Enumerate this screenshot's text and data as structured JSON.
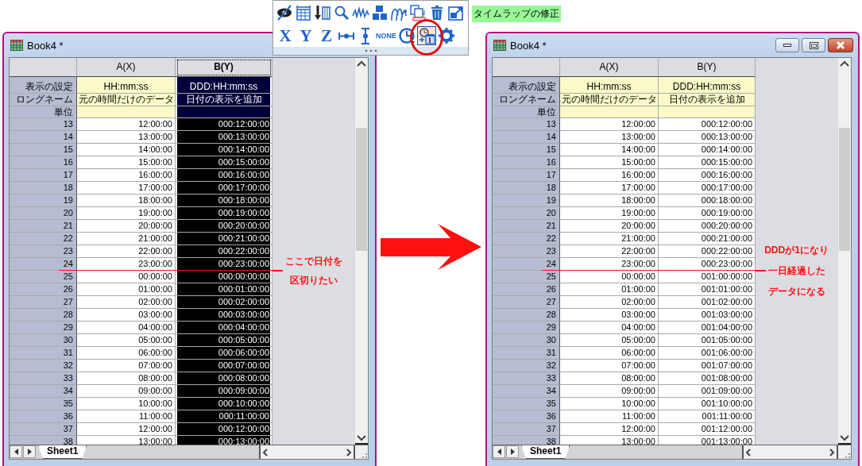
{
  "toolbar": {
    "rows": [
      {
        "buttons": [
          {
            "kind": "hide",
            "highlighted": false
          },
          {
            "kind": "table",
            "highlighted": false
          },
          {
            "kind": "fill",
            "highlighted": false
          },
          {
            "kind": "zoom",
            "highlighted": false
          },
          {
            "kind": "wave",
            "highlighted": false
          },
          {
            "kind": "tiles",
            "highlighted": false
          },
          {
            "kind": "plot",
            "highlighted": false
          },
          {
            "kind": "copy",
            "highlighted": false
          },
          {
            "kind": "delete",
            "highlighted": false
          },
          {
            "kind": "export",
            "highlighted": false
          }
        ]
      },
      {
        "buttons": [
          {
            "kind": "x",
            "label": "X",
            "highlighted": false
          },
          {
            "kind": "y",
            "label": "Y",
            "highlighted": false
          },
          {
            "kind": "z",
            "label": "Z",
            "highlighted": false
          },
          {
            "kind": "xbar",
            "highlighted": false
          },
          {
            "kind": "ybar",
            "highlighted": false
          },
          {
            "kind": "none",
            "label": "NONE",
            "highlighted": false
          },
          {
            "kind": "clock",
            "highlighted": false
          },
          {
            "kind": "timeshift",
            "highlighted": true
          },
          {
            "kind": "settings",
            "highlighted": false
          }
        ]
      }
    ],
    "label": "タイムラップの修正"
  },
  "windows": [
    {
      "title": "Book4 *",
      "caption_buttons": false,
      "columns": [
        {
          "label": "A(X)",
          "selected": false
        },
        {
          "label": "B(Y)",
          "selected": true
        }
      ],
      "label_rows": [
        {
          "label": "表示の設定",
          "cells": [
            "HH:mm:ss",
            "DDD:HH:mm:ss"
          ]
        },
        {
          "label": "ロングネーム",
          "cells": [
            "元の時間だけのデータ",
            "日付の表示を追加"
          ]
        },
        {
          "label": "単位"
        }
      ],
      "rows": [
        {
          "index": "13",
          "cells": [
            "12:00:00",
            "000:12:00:00"
          ],
          "marked": false
        },
        {
          "index": "14",
          "cells": [
            "13:00:00",
            "000:13:00:00"
          ],
          "marked": false
        },
        {
          "index": "15",
          "cells": [
            "14:00:00",
            "000:14:00:00"
          ],
          "marked": false
        },
        {
          "index": "16",
          "cells": [
            "15:00:00",
            "000:15:00:00"
          ],
          "marked": false
        },
        {
          "index": "17",
          "cells": [
            "16:00:00",
            "000:16:00:00"
          ],
          "marked": false
        },
        {
          "index": "18",
          "cells": [
            "17:00:00",
            "000:17:00:00"
          ],
          "marked": false
        },
        {
          "index": "19",
          "cells": [
            "18:00:00",
            "000:18:00:00"
          ],
          "marked": false
        },
        {
          "index": "20",
          "cells": [
            "19:00:00",
            "000:19:00:00"
          ],
          "marked": false
        },
        {
          "index": "21",
          "cells": [
            "20:00:00",
            "000:20:00:00"
          ],
          "marked": false
        },
        {
          "index": "22",
          "cells": [
            "21:00:00",
            "000:21:00:00"
          ],
          "marked": false
        },
        {
          "index": "23",
          "cells": [
            "22:00:00",
            "000:22:00:00"
          ],
          "marked": false
        },
        {
          "index": "24",
          "cells": [
            "23:00:00",
            "000:23:00:00"
          ],
          "marked": true
        },
        {
          "index": "25",
          "cells": [
            "00:00:00",
            "000:00:00:00"
          ],
          "marked": false
        },
        {
          "index": "26",
          "cells": [
            "01:00:00",
            "000:01:00:00"
          ],
          "marked": false
        },
        {
          "index": "27",
          "cells": [
            "02:00:00",
            "000:02:00:00"
          ],
          "marked": false
        },
        {
          "index": "28",
          "cells": [
            "03:00:00",
            "000:03:00:00"
          ],
          "marked": false
        },
        {
          "index": "29",
          "cells": [
            "04:00:00",
            "000:04:00:00"
          ],
          "marked": false
        },
        {
          "index": "30",
          "cells": [
            "05:00:00",
            "000:05:00:00"
          ],
          "marked": false
        },
        {
          "index": "31",
          "cells": [
            "06:00:00",
            "000:06:00:00"
          ],
          "marked": false
        },
        {
          "index": "32",
          "cells": [
            "07:00:00",
            "000:07:00:00"
          ],
          "marked": false
        },
        {
          "index": "33",
          "cells": [
            "08:00:00",
            "000:08:00:00"
          ],
          "marked": false
        },
        {
          "index": "34",
          "cells": [
            "09:00:00",
            "000:09:00:00"
          ],
          "marked": false
        },
        {
          "index": "35",
          "cells": [
            "10:00:00",
            "000:10:00:00"
          ],
          "marked": false
        },
        {
          "index": "36",
          "cells": [
            "11:00:00",
            "000:11:00:00"
          ],
          "marked": false
        },
        {
          "index": "37",
          "cells": [
            "12:00:00",
            "000:12:00:00"
          ],
          "marked": false
        },
        {
          "index": "38",
          "cells": [
            "13:00:00",
            "000:13:00:00"
          ],
          "marked": false
        }
      ],
      "sheet_tabs": [
        {
          "label": "Sheet1",
          "selected": true
        }
      ],
      "annotation": [
        "ここで日付を",
        "区切りたい"
      ]
    },
    {
      "title": "Book4 *",
      "caption_buttons": true,
      "columns": [
        {
          "label": "A(X)",
          "selected": false
        },
        {
          "label": "B(Y)",
          "selected": false
        }
      ],
      "label_rows": [
        {
          "label": "表示の設定",
          "cells": [
            "HH:mm:ss",
            "DDD:HH:mm:ss"
          ]
        },
        {
          "label": "ロングネーム",
          "cells": [
            "元の時間だけのデータ",
            "日付の表示を追加"
          ]
        },
        {
          "label": "単位"
        }
      ],
      "rows": [
        {
          "index": "13",
          "cells": [
            "12:00:00",
            "000:12:00:00"
          ],
          "marked": false
        },
        {
          "index": "14",
          "cells": [
            "13:00:00",
            "000:13:00:00"
          ],
          "marked": false
        },
        {
          "index": "15",
          "cells": [
            "14:00:00",
            "000:14:00:00"
          ],
          "marked": false
        },
        {
          "index": "16",
          "cells": [
            "15:00:00",
            "000:15:00:00"
          ],
          "marked": false
        },
        {
          "index": "17",
          "cells": [
            "16:00:00",
            "000:16:00:00"
          ],
          "marked": false
        },
        {
          "index": "18",
          "cells": [
            "17:00:00",
            "000:17:00:00"
          ],
          "marked": false
        },
        {
          "index": "19",
          "cells": [
            "18:00:00",
            "000:18:00:00"
          ],
          "marked": false
        },
        {
          "index": "20",
          "cells": [
            "19:00:00",
            "000:19:00:00"
          ],
          "marked": false
        },
        {
          "index": "21",
          "cells": [
            "20:00:00",
            "000:20:00:00"
          ],
          "marked": false
        },
        {
          "index": "22",
          "cells": [
            "21:00:00",
            "000:21:00:00"
          ],
          "marked": false
        },
        {
          "index": "23",
          "cells": [
            "22:00:00",
            "000:22:00:00"
          ],
          "marked": false
        },
        {
          "index": "24",
          "cells": [
            "23:00:00",
            "000:23:00:00"
          ],
          "marked": true
        },
        {
          "index": "25",
          "cells": [
            "00:00:00",
            "001:00:00:00"
          ],
          "marked": false
        },
        {
          "index": "26",
          "cells": [
            "01:00:00",
            "001:01:00:00"
          ],
          "marked": false
        },
        {
          "index": "27",
          "cells": [
            "02:00:00",
            "001:02:00:00"
          ],
          "marked": false
        },
        {
          "index": "28",
          "cells": [
            "03:00:00",
            "001:03:00:00"
          ],
          "marked": false
        },
        {
          "index": "29",
          "cells": [
            "04:00:00",
            "001:04:00:00"
          ],
          "marked": false
        },
        {
          "index": "30",
          "cells": [
            "05:00:00",
            "001:05:00:00"
          ],
          "marked": false
        },
        {
          "index": "31",
          "cells": [
            "06:00:00",
            "001:06:00:00"
          ],
          "marked": false
        },
        {
          "index": "32",
          "cells": [
            "07:00:00",
            "001:07:00:00"
          ],
          "marked": false
        },
        {
          "index": "33",
          "cells": [
            "08:00:00",
            "001:08:00:00"
          ],
          "marked": false
        },
        {
          "index": "34",
          "cells": [
            "09:00:00",
            "001:09:00:00"
          ],
          "marked": false
        },
        {
          "index": "35",
          "cells": [
            "10:00:00",
            "001:10:00:00"
          ],
          "marked": false
        },
        {
          "index": "36",
          "cells": [
            "11:00:00",
            "001:11:00:00"
          ],
          "marked": false
        },
        {
          "index": "37",
          "cells": [
            "12:00:00",
            "001:12:00:00"
          ],
          "marked": false
        },
        {
          "index": "38",
          "cells": [
            "13:00:00",
            "001:13:00:00"
          ],
          "marked": false
        }
      ],
      "sheet_tabs": [
        {
          "label": "Sheet1",
          "selected": true
        }
      ],
      "annotation": [
        "DDDが1になり",
        "一日経過した",
        "データになる"
      ]
    }
  ]
}
